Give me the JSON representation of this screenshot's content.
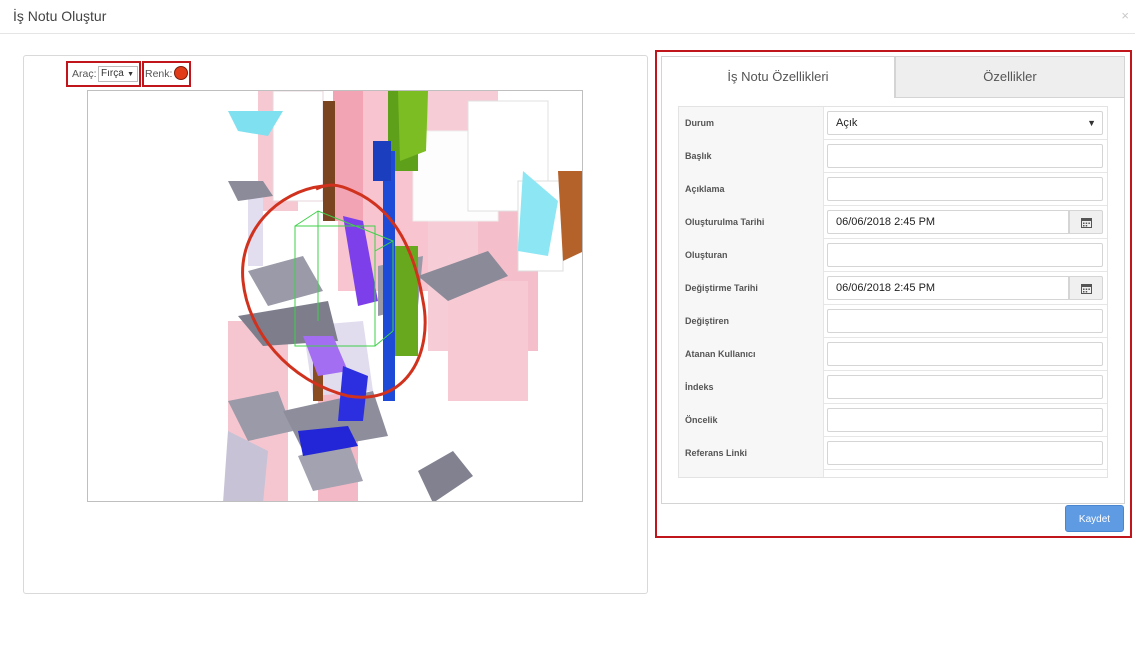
{
  "modal": {
    "title": "İş Notu Oluştur",
    "close": "×"
  },
  "toolbar": {
    "tool_label": "Araç:",
    "tool_value": "Fırça",
    "color_label": "Renk:",
    "color_value": "#e23b1a"
  },
  "tabs": [
    {
      "label": "İş Notu Özellikleri",
      "active": true
    },
    {
      "label": "Özellikler",
      "active": false
    }
  ],
  "fields": [
    {
      "label": "Durum",
      "value": "Açık",
      "type": "select"
    },
    {
      "label": "Başlık",
      "value": "",
      "type": "text"
    },
    {
      "label": "Açıklama",
      "value": "",
      "type": "text"
    },
    {
      "label": "Oluşturulma Tarihi",
      "value": "06/06/2018 2:45 PM",
      "type": "date"
    },
    {
      "label": "Oluşturan",
      "value": "",
      "type": "text"
    },
    {
      "label": "Değiştirme Tarihi",
      "value": "06/06/2018 2:45 PM",
      "type": "date"
    },
    {
      "label": "Değiştiren",
      "value": "",
      "type": "text"
    },
    {
      "label": "Atanan Kullanıcı",
      "value": "",
      "type": "text"
    },
    {
      "label": "İndeks",
      "value": "",
      "type": "text"
    },
    {
      "label": "Öncelik",
      "value": "",
      "type": "text"
    },
    {
      "label": "Referans Linki",
      "value": "",
      "type": "text"
    }
  ],
  "save_button": "Kaydet",
  "colors": {
    "accent": "#5f9be3",
    "highlight": "#c0151b"
  }
}
